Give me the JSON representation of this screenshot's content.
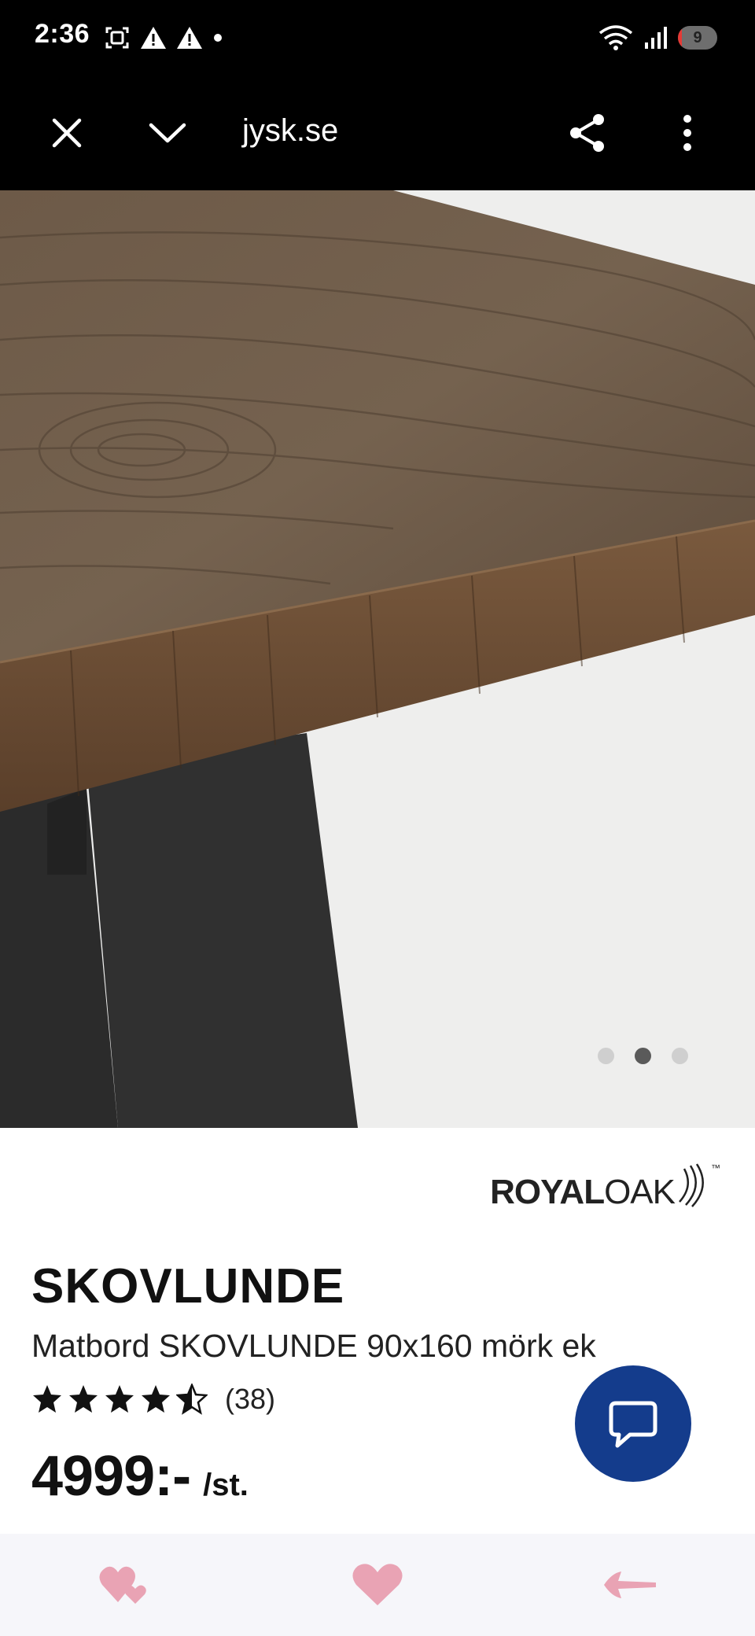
{
  "status_bar": {
    "time": "2:36",
    "battery_level": "9",
    "battery_fraction": 0.09,
    "icons_left": [
      "screenshot-icon",
      "warning-icon",
      "warning-icon",
      "dot-icon"
    ],
    "icons_right": [
      "wifi-icon",
      "signal-icon",
      "battery-icon"
    ]
  },
  "toolbar": {
    "url": "jysk.se",
    "icons": [
      "close-icon",
      "chevron-down-icon",
      "share-icon",
      "more-vert-icon"
    ]
  },
  "gallery": {
    "page_count": 3,
    "active_index": 1
  },
  "product": {
    "brand_part1": "ROYAL",
    "brand_part2": "OAK",
    "brand_tm": "™",
    "name": "SKOVLUNDE",
    "description": "Matbord SKOVLUNDE 90x160 mörk ek",
    "rating": 4.5,
    "rating_count": "(38)",
    "price": "4999:-",
    "price_unit": "/st."
  },
  "chat": {
    "icon": "chat-bubble-icon"
  },
  "bottom_bar": {
    "icons": [
      "heart-outline-icon",
      "heart-icon",
      "back-arrow-icon"
    ]
  },
  "colors": {
    "status_bg": "#000000",
    "chat_fab": "#143c8c",
    "bottom_bar_bg": "#f6f6fa",
    "bottom_icons": "#e9a3b4",
    "battery_low": "#e53935"
  }
}
